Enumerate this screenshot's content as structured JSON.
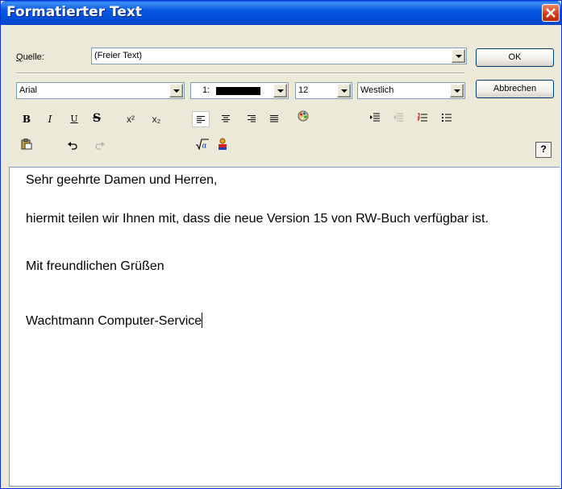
{
  "window": {
    "title": "Formatierter Text"
  },
  "source": {
    "label_first": "Q",
    "label_rest": "uelle:",
    "value": "(Freier Text)"
  },
  "buttons": {
    "ok": "OK",
    "cancel": "Abbrechen",
    "help": "?"
  },
  "format": {
    "font": "Arial",
    "color_prefix": "1:",
    "color_swatch": "#000000",
    "size": "12",
    "script": "Westlich"
  },
  "toolbar": {
    "bold": "B",
    "italic": "I",
    "underline": "U",
    "strike": "S",
    "superscript": "x²",
    "subscript": "x₂"
  },
  "editor": {
    "lines": [
      "Sehr geehrte Damen und Herren,",
      "hiermit teilen wir Ihnen mit, dass die neue Version 15 von RW-Buch verfügbar ist.",
      "Mit freundlichen Grüßen",
      "Wachtmann Computer-Service"
    ]
  }
}
